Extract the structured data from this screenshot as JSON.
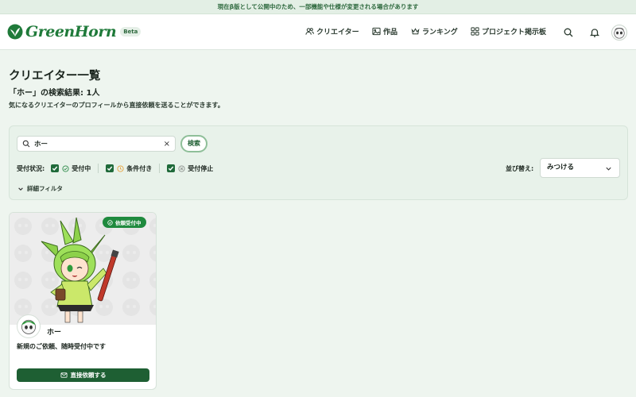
{
  "banner": {
    "text": "現在β版として公開中のため、一部機能や仕様が変更される場合があります"
  },
  "header": {
    "logo_text": "GreenHorn",
    "beta_label": "Beta",
    "nav": {
      "creators": "クリエイター",
      "works": "作品",
      "ranking": "ランキング",
      "project_board": "プロジェクト掲示板"
    }
  },
  "main": {
    "title": "クリエイター一覧",
    "result_count": "「ホー」の検索結果: 1人",
    "description": "気になるクリエイターのプロフィールから直接依頼を送ることができます。"
  },
  "filters": {
    "search_value": "ホー",
    "clear_icon": "×",
    "search_button": "検索",
    "status_label": "受付状況:",
    "statuses": [
      {
        "label": "受付中",
        "checked": true,
        "icon": "check-circle-icon",
        "color": "#2e8b4a"
      },
      {
        "label": "条件付き",
        "checked": true,
        "icon": "clock-icon",
        "color": "#e6a23c"
      },
      {
        "label": "受付停止",
        "checked": true,
        "icon": "x-circle-icon",
        "color": "#8a8f8b"
      }
    ],
    "sort_label": "並び替え:",
    "sort_value": "みつける",
    "detail_filter": "詳細フィルタ"
  },
  "creators": [
    {
      "name": "ホー",
      "badge": "依頼受付中",
      "description": "新規のご依頼、随時受付中です",
      "request_button": "直接依頼する"
    }
  ],
  "colors": {
    "brand_green": "#1f7a3a",
    "dark_green": "#1e5f33",
    "page_bg": "#eef5ef"
  }
}
